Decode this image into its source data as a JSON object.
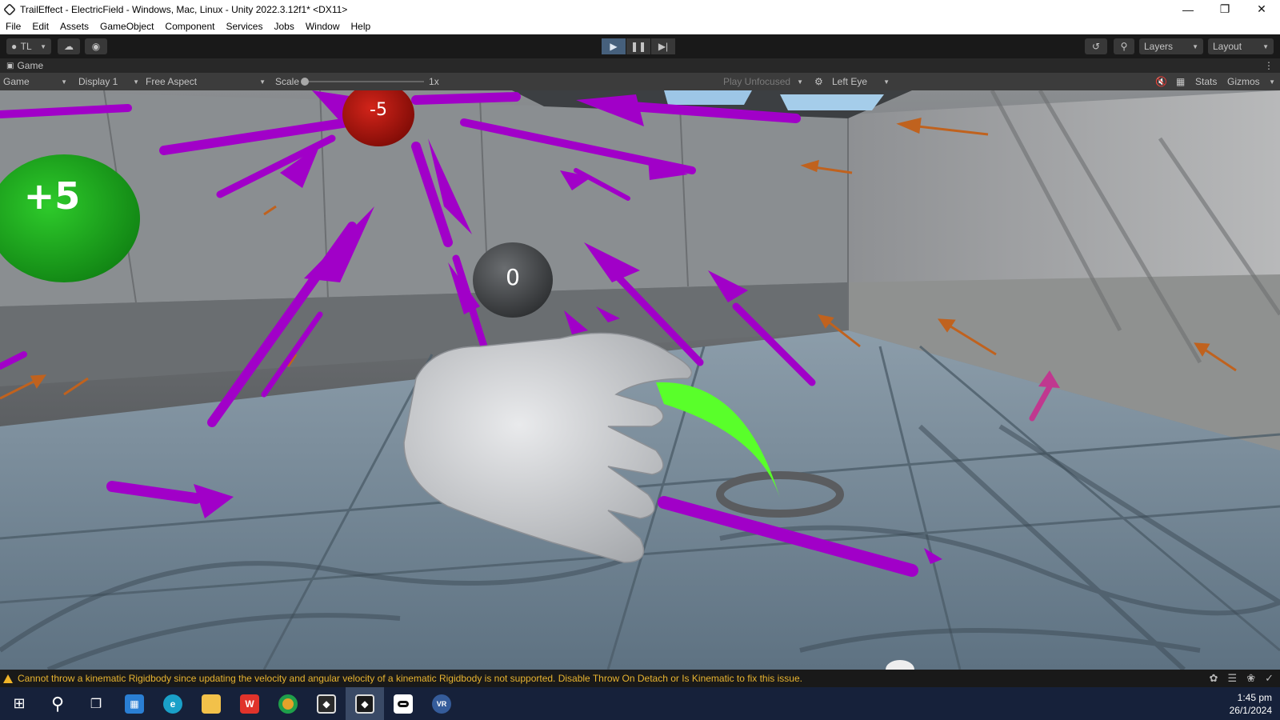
{
  "window": {
    "title": "TrailEffect - ElectricField - Windows, Mac, Linux - Unity 2022.3.12f1* <DX11>",
    "controls": [
      "minimize-icon",
      "restore-icon",
      "close-icon"
    ]
  },
  "menu": [
    "File",
    "Edit",
    "Assets",
    "GameObject",
    "Component",
    "Services",
    "Jobs",
    "Window",
    "Help"
  ],
  "toolbar": {
    "account_label": "TL",
    "layers_label": "Layers",
    "layout_label": "Layout",
    "play_state": "playing"
  },
  "tab": {
    "label": "Game"
  },
  "gamebar": {
    "view_select": "Game",
    "display_select": "Display 1",
    "aspect_select": "Free Aspect",
    "scale_label": "Scale",
    "scale_value": "1x",
    "play_focus": "Play Unfocused",
    "eye_select": "Left Eye",
    "stats_label": "Stats",
    "gizmos_label": "Gizmos"
  },
  "scene": {
    "positive_charge_label": "+5",
    "negative_charge_label": "-5",
    "test_charge_label": "0",
    "colors": {
      "field_arrow": "#a100c8",
      "positive": "#19a81c",
      "negative": "#b51408",
      "trail": "#59ff2a",
      "floor": "#6f8596"
    }
  },
  "status": {
    "message": "Cannot throw a kinematic Rigidbody since updating the velocity and angular velocity of a kinematic Rigidbody is not supported. Disable Throw On Detach or Is Kinematic to fix this issue.",
    "level": "warning"
  },
  "taskbar": {
    "apps": [
      "windows-start-icon",
      "search-icon",
      "task-view-icon",
      "microsoft-store-icon",
      "edge-icon",
      "file-explorer-icon",
      "wps-office-icon",
      "chrome-icon",
      "unity-hub-icon",
      "unity-editor-icon",
      "oculus-icon",
      "steamvr-icon"
    ],
    "time": "1:45 pm",
    "date": "26/1/2024"
  }
}
